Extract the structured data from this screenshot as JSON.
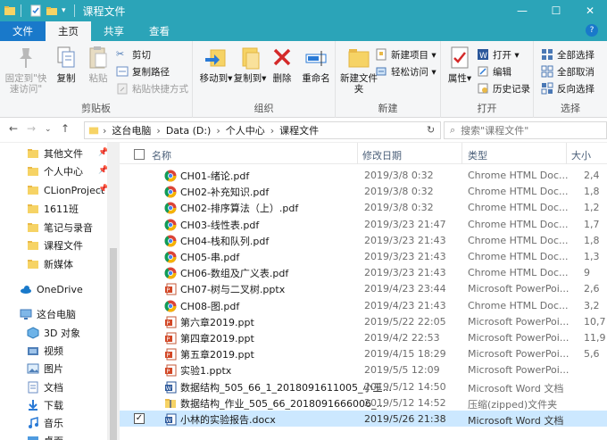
{
  "window": {
    "title": "课程文件",
    "controls": [
      "—",
      "☐",
      "✕"
    ]
  },
  "tabs": [
    "文件",
    "主页",
    "共享",
    "查看"
  ],
  "ribbon": {
    "clipboard": {
      "label": "剪贴板",
      "pin": "固定到\"快速访问\"",
      "copy": "复制",
      "paste": "粘贴",
      "cut": "剪切",
      "copy_path": "复制路径",
      "paste_shortcut": "粘贴快捷方式"
    },
    "organize": {
      "label": "组织",
      "move_to": "移动到",
      "copy_to": "复制到",
      "delete": "删除",
      "rename": "重命名"
    },
    "new": {
      "label": "新建",
      "new_folder": "新建文件夹",
      "new_item": "新建项目",
      "easy_access": "轻松访问"
    },
    "open": {
      "label": "打开",
      "properties": "属性",
      "open": "打开",
      "edit": "编辑",
      "history": "历史记录"
    },
    "select": {
      "label": "选择",
      "select_all": "全部选择",
      "select_none": "全部取消",
      "invert": "反向选择"
    }
  },
  "address": {
    "crumbs": [
      "这台电脑",
      "Data (D:)",
      "个人中心",
      "课程文件"
    ],
    "search_placeholder": "搜索\"课程文件\""
  },
  "nav": {
    "quick": [
      {
        "label": "其他文件",
        "pinned": true
      },
      {
        "label": "个人中心",
        "pinned": true
      },
      {
        "label": "CLionProject",
        "pinned": true
      },
      {
        "label": "1611班",
        "pinned": false
      },
      {
        "label": "笔记与录音",
        "pinned": false
      },
      {
        "label": "课程文件",
        "pinned": false
      },
      {
        "label": "新媒体",
        "pinned": false
      }
    ],
    "onedrive": "OneDrive",
    "this_pc": "这台电脑",
    "pc_items": [
      "3D 对象",
      "视频",
      "图片",
      "文档",
      "下载",
      "音乐",
      "桌面"
    ]
  },
  "columns": {
    "name": "名称",
    "date": "修改日期",
    "type": "类型",
    "size": "大小"
  },
  "files": [
    {
      "name": "CH01-绪论.pdf",
      "date": "2019/3/8 0:32",
      "type": "Chrome HTML Doc...",
      "size": "2,4",
      "icon": "chrome"
    },
    {
      "name": "CH02-补充知识.pdf",
      "date": "2019/3/8 0:32",
      "type": "Chrome HTML Doc...",
      "size": "1,8",
      "icon": "chrome"
    },
    {
      "name": "CH02-排序算法（上）.pdf",
      "date": "2019/3/8 0:32",
      "type": "Chrome HTML Doc...",
      "size": "1,2",
      "icon": "chrome"
    },
    {
      "name": "CH03-线性表.pdf",
      "date": "2019/3/23 21:47",
      "type": "Chrome HTML Doc...",
      "size": "1,7",
      "icon": "chrome"
    },
    {
      "name": "CH04-栈和队列.pdf",
      "date": "2019/3/23 21:43",
      "type": "Chrome HTML Doc...",
      "size": "1,8",
      "icon": "chrome"
    },
    {
      "name": "CH05-串.pdf",
      "date": "2019/3/23 21:43",
      "type": "Chrome HTML Doc...",
      "size": "1,3",
      "icon": "chrome"
    },
    {
      "name": "CH06-数组及广义表.pdf",
      "date": "2019/3/23 21:43",
      "type": "Chrome HTML Doc...",
      "size": "9",
      "icon": "chrome"
    },
    {
      "name": "CH07-树与二叉树.pptx",
      "date": "2019/4/23 23:44",
      "type": "Microsoft PowerPoi...",
      "size": "2,6",
      "icon": "ppt"
    },
    {
      "name": "CH08-图.pdf",
      "date": "2019/4/23 21:43",
      "type": "Chrome HTML Doc...",
      "size": "3,2",
      "icon": "chrome"
    },
    {
      "name": "第六章2019.ppt",
      "date": "2019/5/22 22:05",
      "type": "Microsoft PowerPoi...",
      "size": "10,7",
      "icon": "ppt"
    },
    {
      "name": "第四章2019.ppt",
      "date": "2019/4/2 22:53",
      "type": "Microsoft PowerPoi...",
      "size": "11,9",
      "icon": "ppt"
    },
    {
      "name": "第五章2019.ppt",
      "date": "2019/4/15 18:29",
      "type": "Microsoft PowerPoi...",
      "size": "5,6",
      "icon": "ppt"
    },
    {
      "name": "实验1.pptx",
      "date": "2019/5/5 12:09",
      "type": "Microsoft PowerPoi...",
      "size": "",
      "icon": "ppt"
    },
    {
      "name": "数据结构_505_66_1_2018091611005_小王...",
      "date": "2019/5/12 14:50",
      "type": "Microsoft Word 文档",
      "size": "",
      "icon": "word"
    },
    {
      "name": "数据结构_作业_505_66_2018091666006_...",
      "date": "2019/5/12 14:52",
      "type": "压缩(zipped)文件夹",
      "size": "",
      "icon": "zip"
    },
    {
      "name": "小林的实验报告.docx",
      "date": "2019/5/26 21:38",
      "type": "Microsoft Word 文档",
      "size": "",
      "icon": "word",
      "selected": true
    }
  ]
}
